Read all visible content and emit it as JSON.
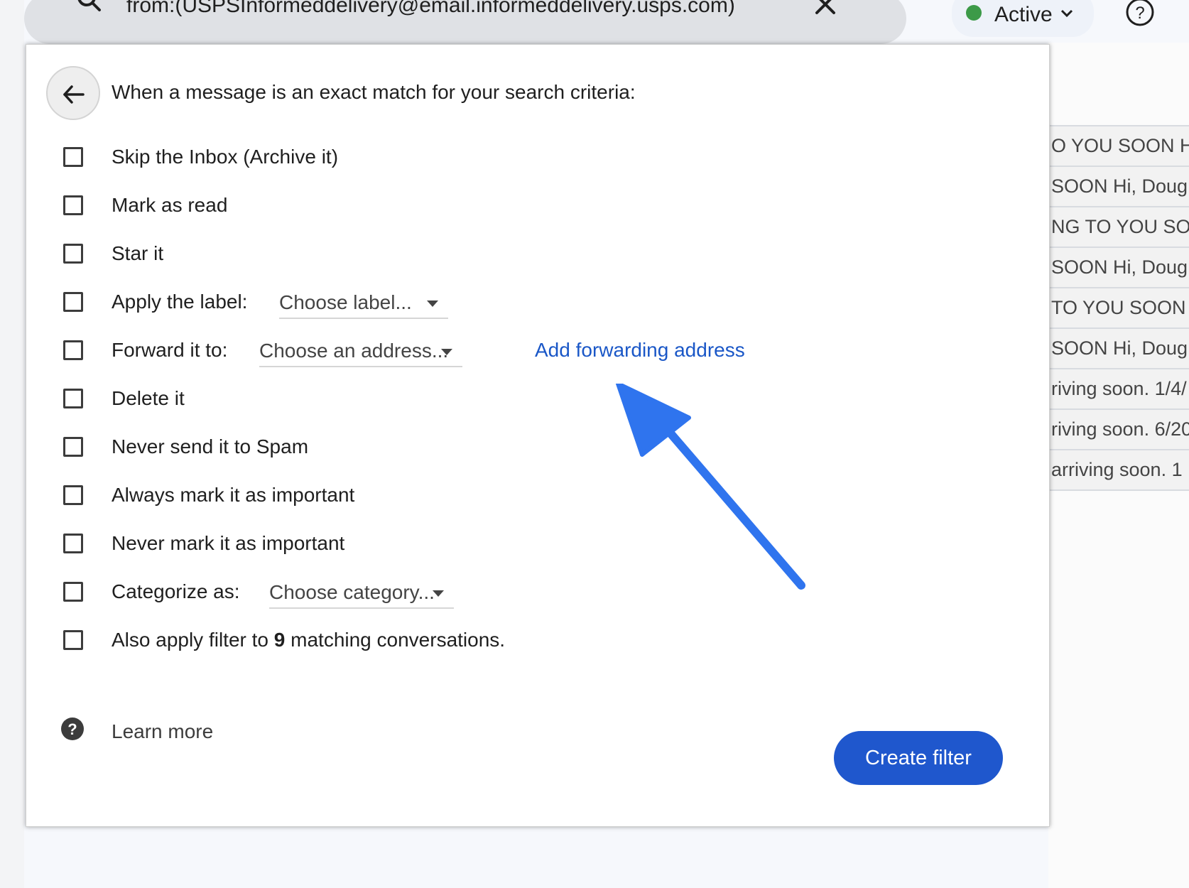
{
  "search": {
    "query": "from:(USPSInformeddelivery@email.informeddelivery.usps.com)",
    "search_icon": "search-icon",
    "clear_icon": "close-icon"
  },
  "status": {
    "label": "Active",
    "dot_color": "#3c9a48",
    "chevron_icon": "chevron-down-icon"
  },
  "help_icon": "help-circle-icon",
  "background_list": [
    "O YOU SOON Hi",
    "SOON Hi, Doug",
    "NG TO YOU SOO",
    "SOON Hi, Doug",
    "TO YOU SOON H",
    "SOON Hi, Doug!",
    "riving soon. 1/4/",
    "riving soon. 6/20",
    "arriving soon. 1"
  ],
  "dialog": {
    "back_icon": "arrow-left-icon",
    "header": "When a message is an exact match for your search criteria:",
    "options": {
      "skip_inbox": "Skip the Inbox (Archive it)",
      "mark_read": "Mark as read",
      "star": "Star it",
      "apply_label": "Apply the label:",
      "label_select": "Choose label...",
      "forward": "Forward it to:",
      "address_select": "Choose an address...",
      "add_forwarding": "Add forwarding address",
      "delete": "Delete it",
      "never_spam": "Never send it to Spam",
      "always_important": "Always mark it as important",
      "never_important": "Never mark it as important",
      "categorize": "Categorize as:",
      "category_select": "Choose category...",
      "also_apply_prefix": "Also apply filter to",
      "matching_count": "9",
      "also_apply_suffix": "matching conversations."
    },
    "learn_more": "Learn more",
    "create_filter": "Create filter"
  },
  "colors": {
    "primary_button": "#1f57cd",
    "link": "#1a57c7",
    "annotation_arrow": "#2f74ee"
  }
}
